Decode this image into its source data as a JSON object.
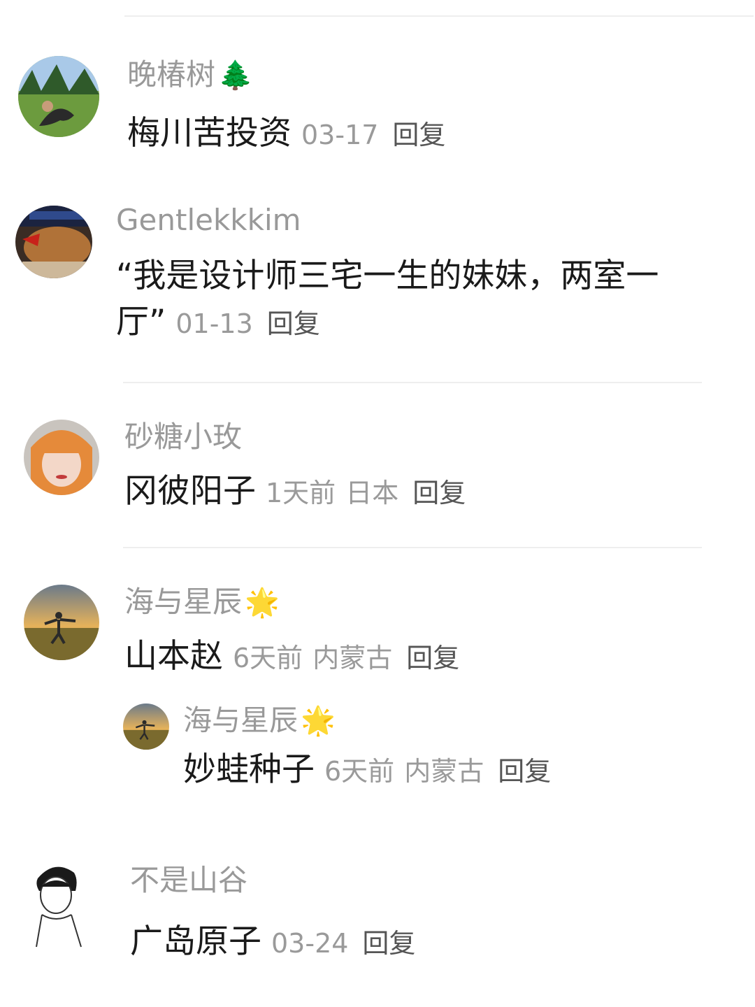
{
  "reply_label": "回复",
  "comments": [
    {
      "username": "晚椿树",
      "username_emoji": "🌲",
      "text": "梅川苦投资",
      "date": "03-17",
      "location": ""
    },
    {
      "username": "Gentlekkkim",
      "username_emoji": "",
      "text": "“我是设计师三宅一生的妹妹，两室一厅”",
      "date": "01-13",
      "location": ""
    },
    {
      "username": "砂糖小玫",
      "username_emoji": "",
      "text": "冈彼阳子",
      "date": "1天前",
      "location": "日本"
    },
    {
      "username": "海与星辰",
      "username_emoji": "🌟",
      "text": "山本赵",
      "date": "6天前",
      "location": "内蒙古",
      "replies": [
        {
          "username": "海与星辰",
          "username_emoji": "🌟",
          "text": "妙蛙种子",
          "date": "6天前",
          "location": "内蒙古"
        }
      ]
    },
    {
      "username": "不是山谷",
      "username_emoji": "",
      "text": "广岛原子",
      "date": "03-24",
      "location": ""
    }
  ],
  "colors": {
    "username": "#999999",
    "comment_text": "#1a1a1a",
    "meta": "#9a9a9a",
    "divider": "#eeeeee"
  }
}
